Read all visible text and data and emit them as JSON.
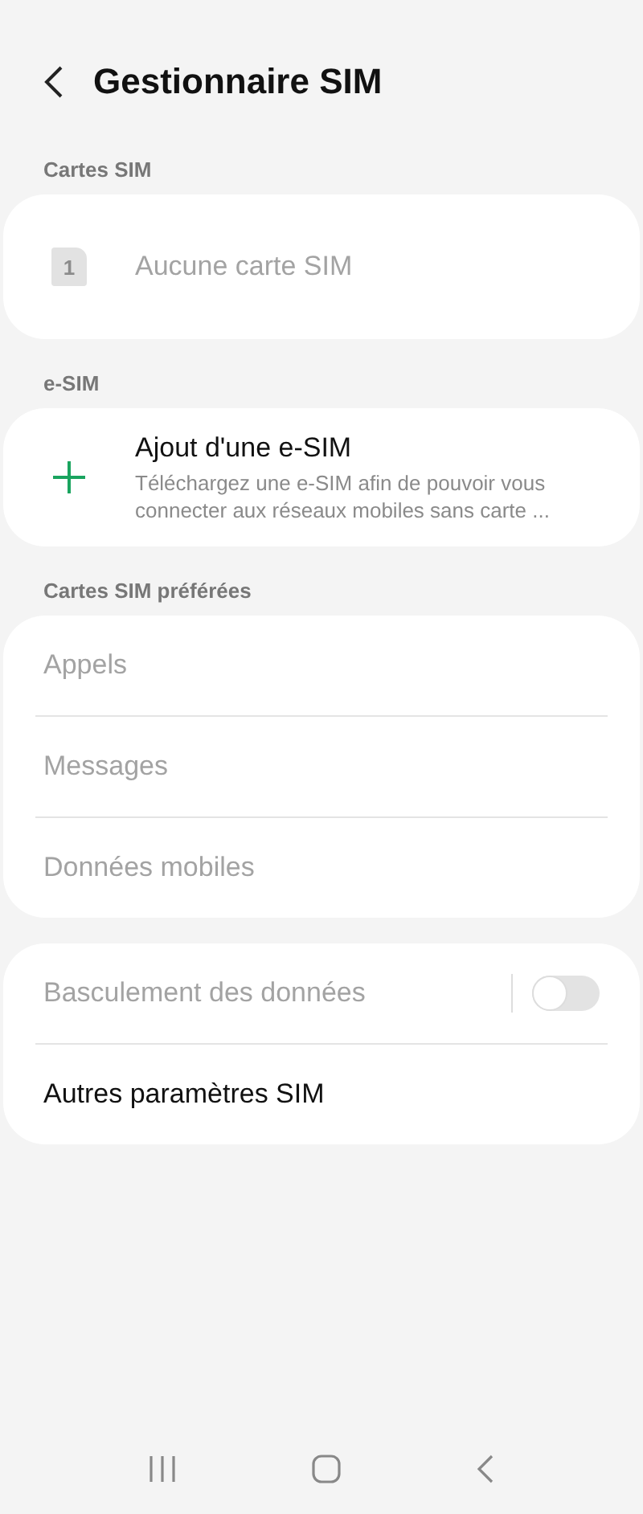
{
  "header": {
    "title": "Gestionnaire SIM"
  },
  "sections": [
    {
      "label": "Cartes SIM",
      "items": [
        {
          "kind": "sim",
          "slot": "1",
          "title": "Aucune carte SIM",
          "disabled": true
        }
      ]
    },
    {
      "label": "e-SIM",
      "items": [
        {
          "kind": "add",
          "title": "Ajout d'une e-SIM",
          "subtitle": "Téléchargez une e-SIM afin de pouvoir vous connecter aux réseaux mobiles sans carte ...",
          "disabled": false
        }
      ]
    },
    {
      "label": "Cartes SIM préférées",
      "items": [
        {
          "kind": "plain",
          "title": "Appels",
          "disabled": true
        },
        {
          "kind": "plain",
          "title": "Messages",
          "disabled": true
        },
        {
          "kind": "plain",
          "title": "Données mobiles",
          "disabled": true
        }
      ]
    },
    {
      "items": [
        {
          "kind": "switch",
          "title": "Basculement des données",
          "disabled": true,
          "on": false
        },
        {
          "kind": "plain",
          "title": "Autres paramètres SIM",
          "disabled": false
        }
      ]
    }
  ]
}
